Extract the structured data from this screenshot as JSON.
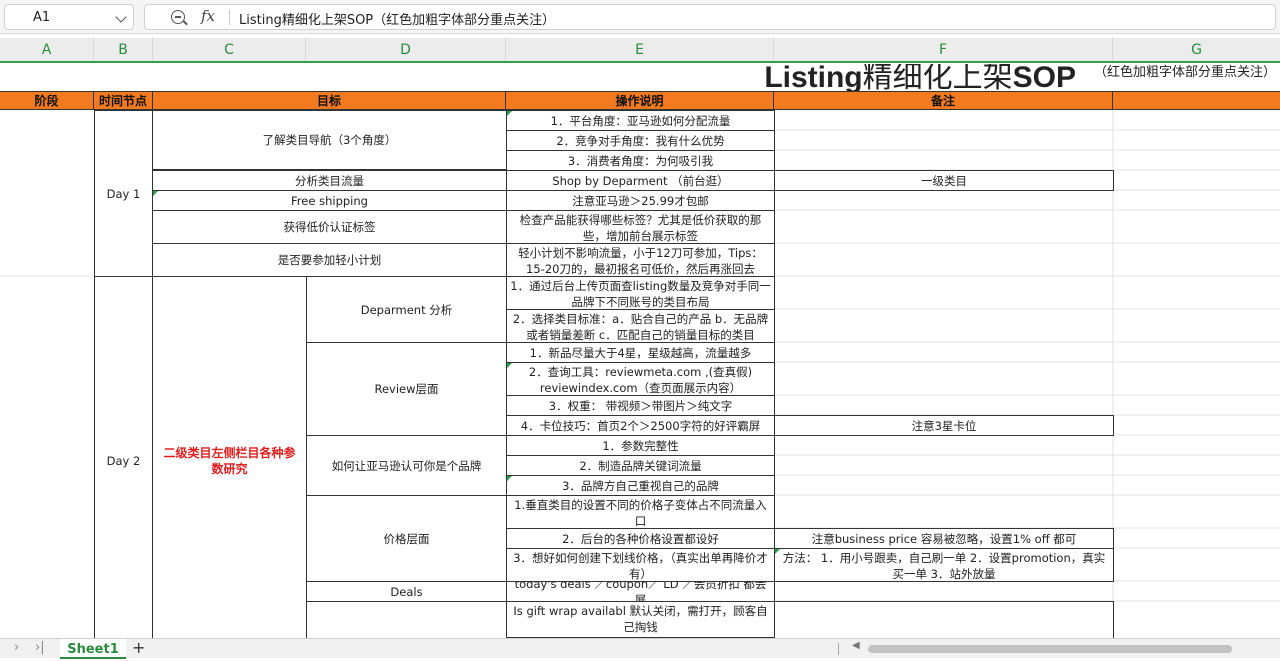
{
  "formula_bar": {
    "cell_ref": "A1",
    "formula_icon_label": "fx",
    "content": "Listing精细化上架SOP（红色加粗字体部分重点关注）"
  },
  "columns": [
    "A",
    "B",
    "C",
    "D",
    "E",
    "F",
    "G"
  ],
  "title": {
    "bold_part1": "Listing",
    "normal_part": "精细化上架",
    "bold_part2": "SOP",
    "subtitle": "（红色加粗字体部分重点关注）"
  },
  "headers": {
    "stage": "阶段",
    "time": "时间节点",
    "goal": "目标",
    "instructions": "操作说明",
    "notes": "备注"
  },
  "rows": {
    "day1": "Day 1",
    "day2": "Day 2",
    "category_nav": "了解类目导航（3个角度）",
    "cn1": "1．平台角度：亚马逊如何分配流量",
    "cn2": "2．竞争对手角度：我有什么优势",
    "cn3": "3．消费者角度：为何吸引我",
    "analyze_traffic": "分析类目流量",
    "shop_by_dept": "Shop by Deparment （前台逛）",
    "level1_category": "一级类目",
    "free_shipping": "Free shipping",
    "free_shipping_note": "注意亚马逊＞25.99才包邮",
    "low_price_label": "获得低价认证标签",
    "low_price_desc": "检查产品能获得哪些标签？尤其是低价获取的那些，增加前台展示标签",
    "light_plan": "是否要参加轻小计划",
    "light_plan_desc": "轻小计划不影响流量，小于12刀可参加，Tips：15-20刀的，最初报名可低价，然后再涨回去",
    "level2_research": "二级类目左侧栏目各种参数研究",
    "dept_analysis": "Deparment 分析",
    "da1": "1．通过后台上传页面查listing数量及竞争对手同一品牌下不同账号的类目布局",
    "da2": "2．选择类目标准：a．贴合自己的产品 b．无品牌或者销量差断 c．匹配自己的销量目标的类目",
    "review_level": "Review层面",
    "rv1": "1．新品尽量大于4星，星级越高，流量越多",
    "rv2": "2．查询工具：reviewmeta.com ,(查真假) reviewindex.com（查页面展示内容）",
    "rv3": "3．权重： 带视频＞带图片＞纯文字",
    "rv4": "4．卡位技巧：首页2个＞2500字符的好评霸屏",
    "rv4_note": "注意3星卡位",
    "brand_recognition": "如何让亚马逊认可你是个品牌",
    "br1": "1．参数完整性",
    "br2": "2．制造品牌关键词流量",
    "br3": "3．品牌方自己重视自己的品牌",
    "price_level": "价格层面",
    "pr1": "1.垂直类目的设置不同的价格子变体占不同流量入口",
    "pr2": "2．后台的各种价格设置都设好",
    "pr2_note": "注意business price 容易被忽略，设置1% off 都可",
    "pr3": "3．想好如何创建下划线价格，（真实出单再降价才有）",
    "pr3_note": "方法： 1．用小号跟卖，自己刷一单 2．设置promotion，真实买一单 3．站外放量",
    "deals": "Deals",
    "deals_desc": "today's deals ／coupon／ LD ／会员折扣 都会展",
    "gift_wrap": "Is gift wrap availabl 默认关闭，需打开，顾客自己掏钱"
  },
  "sheet_tabs": [
    "Sheet1"
  ],
  "add_sheet": "+"
}
